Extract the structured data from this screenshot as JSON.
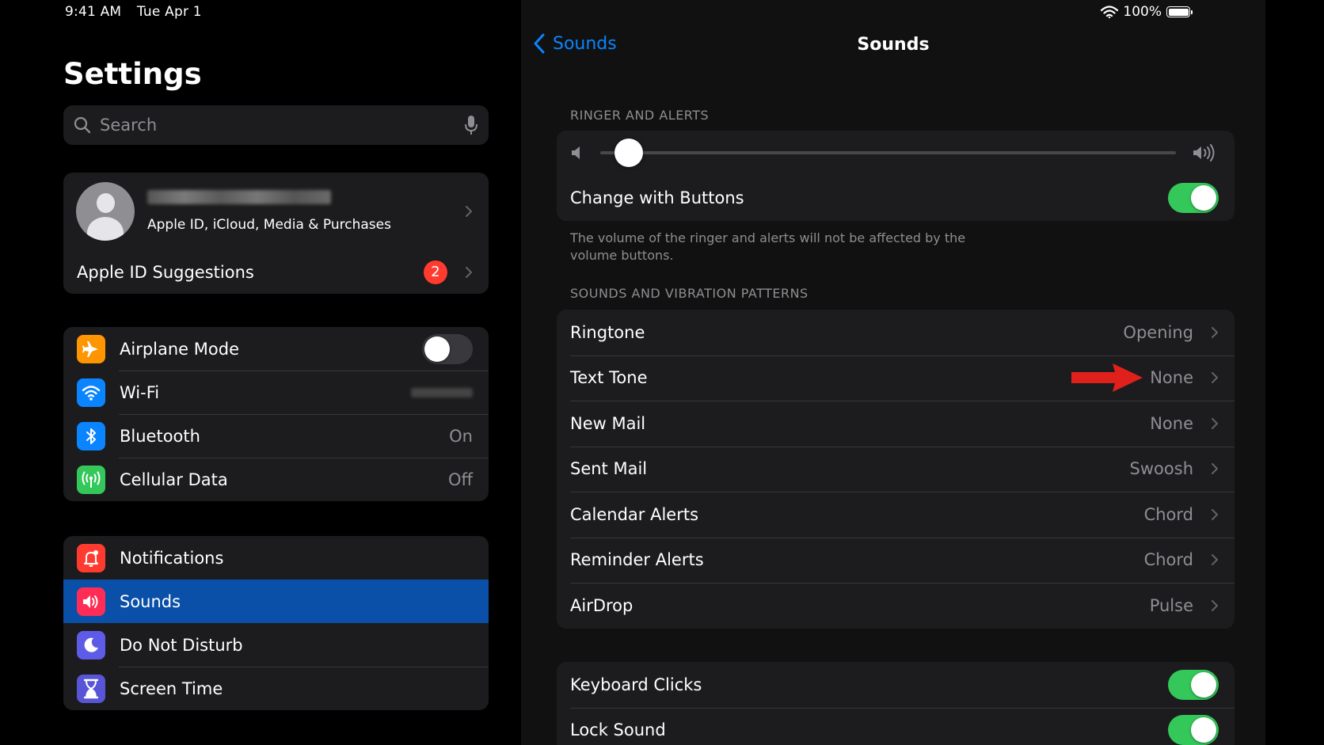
{
  "status_bar": {
    "time": "9:41 AM",
    "date": "Tue Apr 1",
    "battery": "100%",
    "battery_icon": "battery-full-icon",
    "wifi_icon": "wifi-icon"
  },
  "sidebar": {
    "title": "Settings",
    "search": {
      "placeholder": "Search"
    },
    "profile": {
      "subtitle": "Apple ID, iCloud, Media & Purchases"
    },
    "suggestions": {
      "label": "Apple ID Suggestions",
      "badge": "2"
    },
    "connectivity": [
      {
        "label": "Airplane Mode",
        "icon": "airplane-icon",
        "color": "#ff9500",
        "toggle": "off"
      },
      {
        "label": "Wi-Fi",
        "icon": "wifi-icon",
        "color": "#0a84ff"
      },
      {
        "label": "Bluetooth",
        "icon": "bluetooth-icon",
        "color": "#0a84ff",
        "value": "On"
      },
      {
        "label": "Cellular Data",
        "icon": "antenna-icon",
        "color": "#34c759",
        "value": "Off"
      }
    ],
    "system": [
      {
        "label": "Notifications",
        "icon": "notification-bell-icon",
        "color": "#ff3b30"
      },
      {
        "label": "Sounds",
        "icon": "speaker-icon",
        "color": "#ff2d55",
        "selected": true
      },
      {
        "label": "Do Not Disturb",
        "icon": "moon-icon",
        "color": "#5e5ce6"
      },
      {
        "label": "Screen Time",
        "icon": "hourglass-icon",
        "color": "#5856d6"
      }
    ]
  },
  "detail": {
    "back_label": "Sounds",
    "title": "Sounds",
    "ringer_header": "RINGER AND ALERTS",
    "volume_level": 0.05,
    "change_with_buttons": {
      "label": "Change with Buttons",
      "toggle": "on"
    },
    "ringer_note": "The volume of the ringer and alerts will not be affected by the volume buttons.",
    "patterns_header": "SOUNDS AND VIBRATION PATTERNS",
    "patterns": [
      {
        "label": "Ringtone",
        "value": "Opening"
      },
      {
        "label": "Text Tone",
        "value": "None"
      },
      {
        "label": "New Mail",
        "value": "None"
      },
      {
        "label": "Sent Mail",
        "value": "Swoosh"
      },
      {
        "label": "Calendar Alerts",
        "value": "Chord"
      },
      {
        "label": "Reminder Alerts",
        "value": "Chord"
      },
      {
        "label": "AirDrop",
        "value": "Pulse"
      }
    ],
    "other": [
      {
        "label": "Keyboard Clicks",
        "toggle": "on"
      },
      {
        "label": "Lock Sound",
        "toggle": "on"
      }
    ],
    "annotation_color": "#e0201b"
  }
}
